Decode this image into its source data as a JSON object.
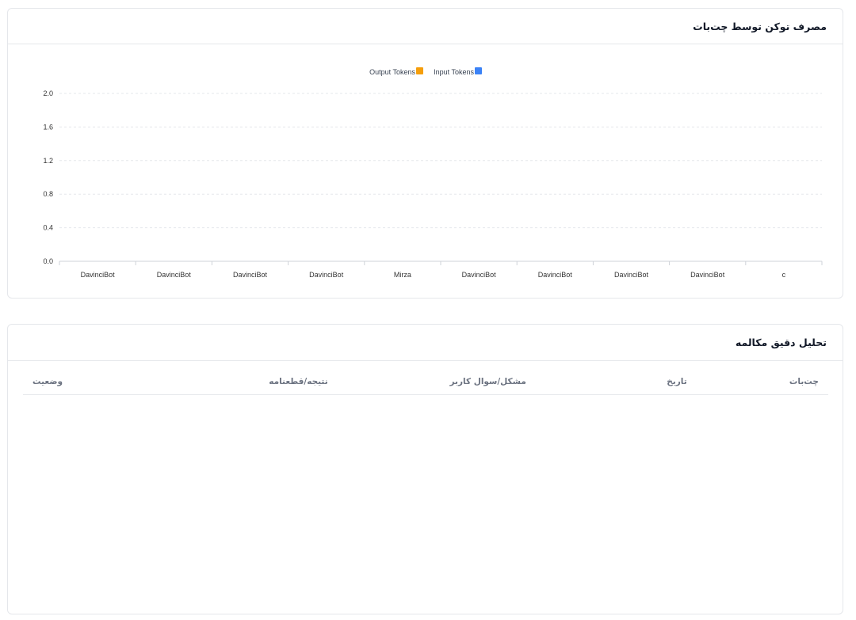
{
  "token_card": {
    "title": "مصرف توکن توسط چت‌بات"
  },
  "chart_data": {
    "type": "bar",
    "categories": [
      "DavinciBot",
      "DavinciBot",
      "DavinciBot",
      "DavinciBot",
      "Mirza",
      "DavinciBot",
      "DavinciBot",
      "DavinciBot",
      "DavinciBot",
      "c"
    ],
    "series": [
      {
        "name": "Input Tokens",
        "color": "#3b82f6",
        "values": [
          0,
          0,
          0,
          0,
          0,
          0,
          0,
          0,
          0,
          0
        ]
      },
      {
        "name": "Output Tokens",
        "color": "#f59e0b",
        "values": [
          0,
          0,
          0,
          0,
          0,
          0,
          0,
          0,
          0,
          0
        ]
      }
    ],
    "yticks": [
      "0.0",
      "0.4",
      "0.8",
      "1.2",
      "1.6",
      "2.0"
    ],
    "ylim": [
      0,
      2.0
    ],
    "grid": true,
    "legend_position": "top-center"
  },
  "analysis_card": {
    "title": "تحلیل دقیق مکالمه",
    "columns": {
      "chatbot": "چت‌بات",
      "date": "تاریخ",
      "issue": "مشکل/سوال کاربر",
      "result": "نتیجه/قطعنامه",
      "status": "وضعیت"
    },
    "rows": []
  }
}
